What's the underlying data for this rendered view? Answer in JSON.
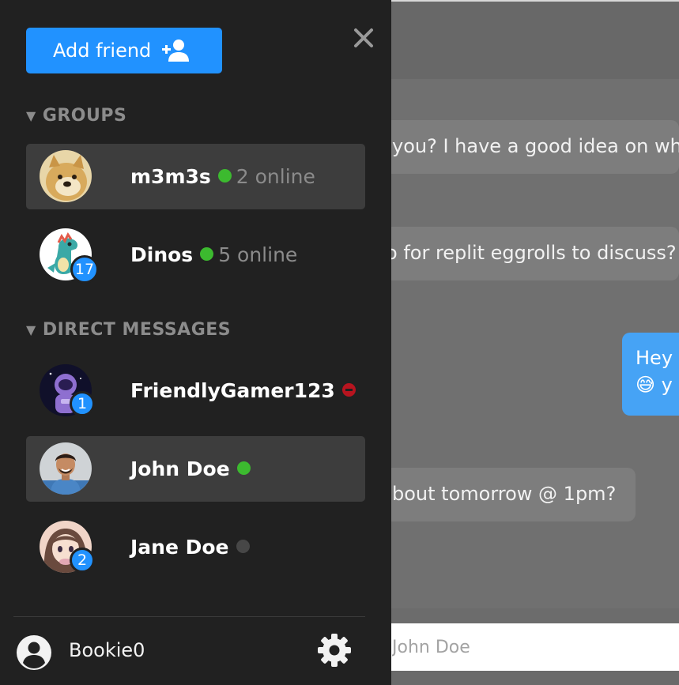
{
  "drawer": {
    "add_friend_label": "Add friend",
    "groups_heading": "GROUPS",
    "dm_heading": "DIRECT MESSAGES",
    "groups": [
      {
        "name": "m3m3s",
        "online_text": "2 online",
        "status": "online",
        "selected": true,
        "badge": ""
      },
      {
        "name": "Dinos",
        "online_text": "5 online",
        "status": "online",
        "selected": false,
        "badge": "17"
      }
    ],
    "direct_messages": [
      {
        "name": "FriendlyGamer123",
        "status": "do-not-disturb",
        "selected": false,
        "badge": "1"
      },
      {
        "name": "John Doe",
        "status": "online",
        "selected": true,
        "badge": ""
      },
      {
        "name": "Jane Doe",
        "status": "offline",
        "selected": false,
        "badge": "2"
      }
    ],
    "current_user": "Bookie0"
  },
  "chat": {
    "messages": [
      {
        "text": "you? I have a good idea on wh",
        "direction": "incoming"
      },
      {
        "text": "o for replit eggrolls to discuss?",
        "direction": "incoming"
      },
      {
        "line1": "Hey",
        "line2": "😅 y",
        "direction": "outgoing"
      },
      {
        "text": "bout tomorrow @ 1pm?",
        "direction": "incoming"
      }
    ],
    "composer_placeholder": "John Doe"
  },
  "colors": {
    "accent": "#2192ff",
    "online": "#3cba2f",
    "dnd": "#b7141f",
    "drawer_bg": "#212121",
    "selected_row": "#3d3d3d",
    "outgoing_bubble": "#46a3f5"
  }
}
